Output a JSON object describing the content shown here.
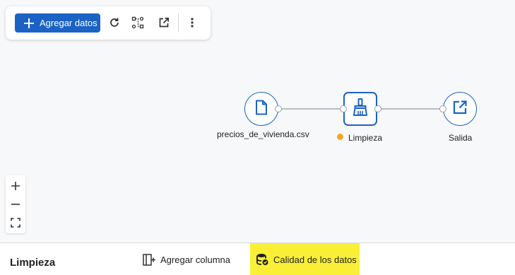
{
  "toolbar": {
    "add_data_label": "Agregar datos",
    "icons": [
      "plus-icon",
      "refresh-icon",
      "flow-layout-icon",
      "open-external-icon",
      "more-vertical-icon"
    ]
  },
  "flow": {
    "nodes": [
      {
        "label": "precios_de_vivienda.csv",
        "icon": "file-icon"
      },
      {
        "label": "Limpieza",
        "icon": "broom-icon",
        "status": "pending"
      },
      {
        "label": "Salida",
        "icon": "open-external-icon"
      }
    ]
  },
  "zoom": {
    "icons": [
      "zoom-in-icon",
      "zoom-out-icon",
      "fit-view-icon"
    ]
  },
  "bottom_panel": {
    "title": "Limpieza",
    "add_column_label": "Agregar columna",
    "data_quality_label": "Calidad de los datos"
  },
  "colors": {
    "accent": "#1a63c4",
    "status_pending": "#f5a623",
    "highlight": "#f9ef37"
  }
}
